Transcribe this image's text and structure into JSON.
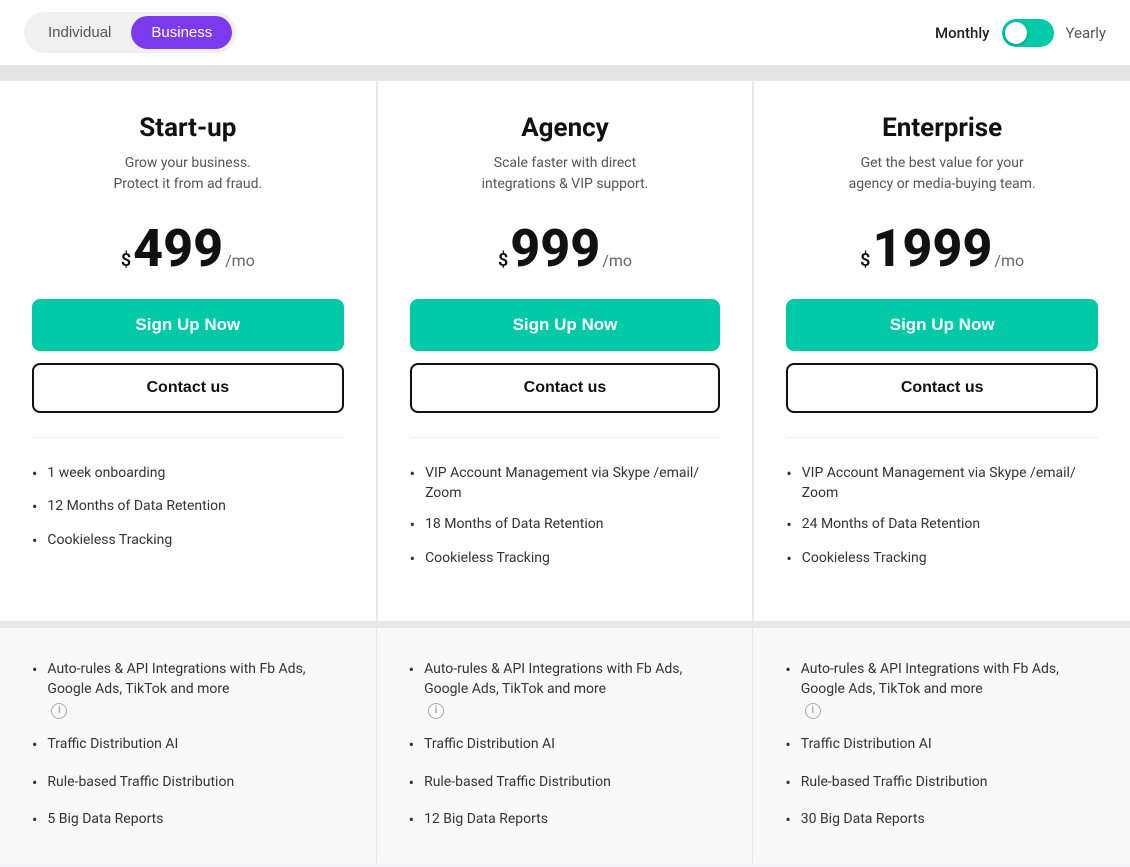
{
  "header": {
    "toggle": {
      "individual_label": "Individual",
      "business_label": "Business",
      "active_plan": "Business",
      "monthly_label": "Monthly",
      "yearly_label": "Yearly",
      "billing_active": "monthly"
    }
  },
  "plans": [
    {
      "id": "startup",
      "name": "Start-up",
      "description": "Grow your business.\nProtect it from ad fraud.",
      "price_dollar": "$",
      "price_amount": "499",
      "price_period": "/mo",
      "signup_label": "Sign Up Now",
      "contact_label": "Contact us",
      "features_top": [
        "1 week onboarding",
        "12 Months of Data Retention",
        "Cookieless Tracking"
      ],
      "features_bottom": [
        "Auto-rules & API Integrations with Fb Ads, Google Ads, TikTok and more",
        "Traffic Distribution AI",
        "Rule-based Traffic Distribution",
        "5 Big Data Reports"
      ],
      "has_info_icon": [
        true,
        false,
        false,
        false
      ]
    },
    {
      "id": "agency",
      "name": "Agency",
      "description": "Scale faster with direct\nintegrations & VIP support.",
      "price_dollar": "$",
      "price_amount": "999",
      "price_period": "/mo",
      "signup_label": "Sign Up Now",
      "contact_label": "Contact us",
      "features_top": [
        "VIP Account Management via Skype /email/ Zoom",
        "18 Months of Data Retention",
        "Cookieless Tracking"
      ],
      "features_bottom": [
        "Auto-rules & API Integrations with Fb Ads, Google Ads, TikTok and more",
        "Traffic Distribution AI",
        "Rule-based Traffic Distribution",
        "12 Big Data Reports"
      ],
      "has_info_icon": [
        true,
        false,
        false,
        false
      ]
    },
    {
      "id": "enterprise",
      "name": "Enterprise",
      "description": "Get the best value for your\nagency or media-buying team.",
      "price_dollar": "$",
      "price_amount": "1999",
      "price_period": "/mo",
      "signup_label": "Sign Up Now",
      "contact_label": "Contact us",
      "features_top": [
        "VIP Account Management via Skype /email/ Zoom",
        "24 Months of Data Retention",
        "Cookieless Tracking"
      ],
      "features_bottom": [
        "Auto-rules & API Integrations with Fb Ads, Google Ads, TikTok and more",
        "Traffic Distribution AI",
        "Rule-based Traffic Distribution",
        "30 Big Data Reports"
      ],
      "has_info_icon": [
        true,
        false,
        false,
        false
      ]
    }
  ]
}
